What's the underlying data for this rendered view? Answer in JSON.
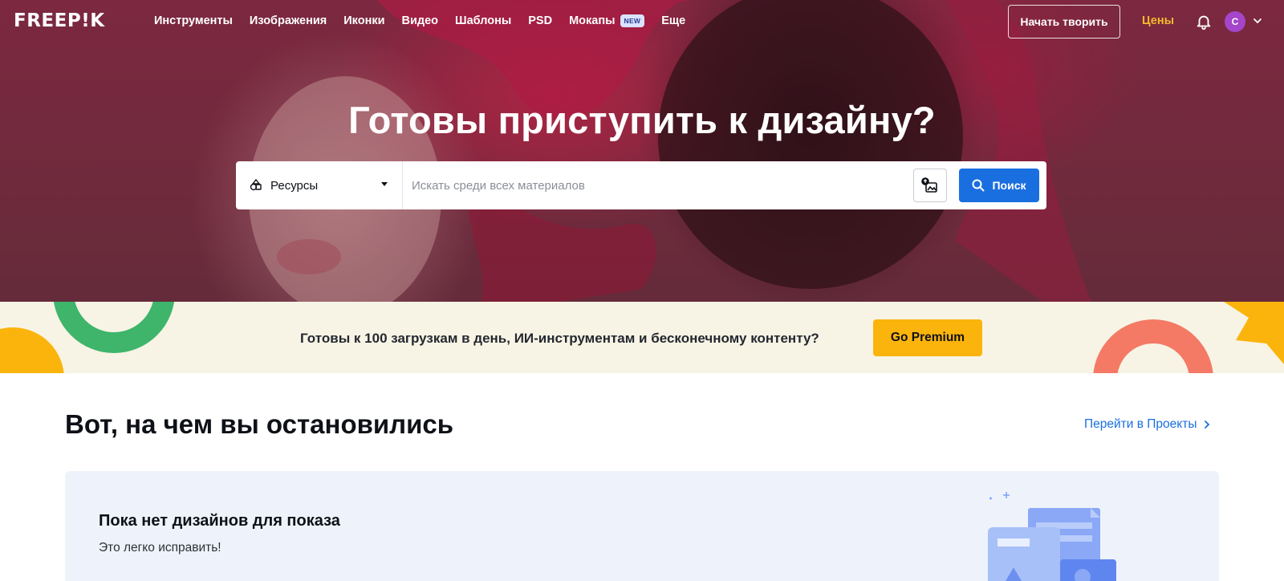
{
  "header": {
    "logo": "FREEP!K",
    "nav": [
      {
        "label": "Инструменты"
      },
      {
        "label": "Изображения"
      },
      {
        "label": "Иконки"
      },
      {
        "label": "Видео"
      },
      {
        "label": "Шаблоны"
      },
      {
        "label": "PSD"
      },
      {
        "label": "Мокапы",
        "badge": "NEW"
      },
      {
        "label": "Еще"
      }
    ],
    "start_button": "Начать творить",
    "pricing_link": "Цены",
    "avatar_letter": "С",
    "icons": {
      "notifications": "bell-icon",
      "menu": "chevron-down-icon"
    }
  },
  "hero": {
    "title": "Готовы приступить к дизайну?",
    "search": {
      "resource_selected": "Ресурсы",
      "placeholder": "Искать среди всех материалов",
      "value": "",
      "button_label": "Поиск"
    }
  },
  "promo": {
    "text": "Готовы к 100 загрузкам в день, ИИ-инструментам и бесконечному контенту?",
    "button_label": "Go Premium"
  },
  "recent": {
    "title": "Вот, на чем вы остановились",
    "link_label": "Перейти в Проекты",
    "empty_title": "Пока нет дизайнов для показа",
    "empty_subtitle": "Это легко исправить!"
  },
  "colors": {
    "accent_blue": "#1a6fe0",
    "pricing_yellow": "#f5b82e",
    "premium_yellow": "#fbb40c",
    "promo_bg": "#f8f4e5",
    "card_bg": "#eef3fb",
    "avatar": "#a545c9"
  }
}
